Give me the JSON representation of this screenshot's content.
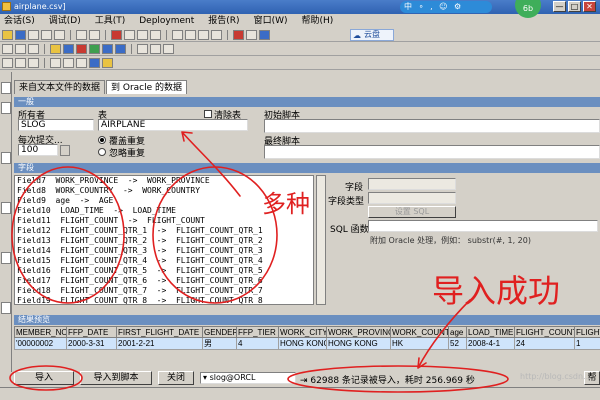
{
  "window": {
    "title": "airplane.csv]",
    "ime_text": "中 ∘ , ☺ ⚙",
    "controls": [
      "—",
      "□",
      "✕"
    ],
    "avatar_text": "6b"
  },
  "menu": [
    "会话(S)",
    "调试(D)",
    "工具(T)",
    "Deployment",
    "报告(R)",
    "窗口(W)",
    "帮助(H)"
  ],
  "cloud_label": "云盘",
  "tabs": [
    "来自文本文件的数据",
    "到 Oracle 的数据"
  ],
  "general": {
    "section_title": "一般",
    "owner_label": "所有者",
    "owner_value": "SLOG",
    "table_label": "表",
    "table_value": "AIRPLANE",
    "truncate_label": "清除表",
    "commit_label": "每次提交...",
    "commit_value": "100",
    "radio_overwrite": "覆盖重复",
    "radio_ignore": "忽略重复",
    "initial_script_label": "初始脚本",
    "final_script_label": "最终脚本"
  },
  "fields": {
    "section_title": "字段",
    "rows": [
      "Field7  WORK_PROVINCE  ->  WORK_PROVINCE",
      "Field8  WORK_COUNTRY  ->  WORK_COUNTRY",
      "Field9  age  ->  AGE",
      "Field10  LOAD_TIME  ->  LOAD_TIME",
      "Field11  FLIGHT_COUNT  ->  FLIGHT_COUNT",
      "Field12  FLIGHT_COUNT_QTR_1  ->  FLIGHT_COUNT_QTR_1",
      "Field13  FLIGHT_COUNT_QTR_2  ->  FLIGHT_COUNT_QTR_2",
      "Field14  FLIGHT_COUNT_QTR_3  ->  FLIGHT_COUNT_QTR_3",
      "Field15  FLIGHT_COUNT_QTR_4  ->  FLIGHT_COUNT_QTR_4",
      "Field16  FLIGHT_COUNT_QTR_5  ->  FLIGHT_COUNT_QTR_5",
      "Field17  FLIGHT_COUNT_QTR_6  ->  FLIGHT_COUNT_QTR_6",
      "Field18  FLIGHT_COUNT_QTR_7  ->  FLIGHT_COUNT_QTR_7",
      "Field19  FLIGHT_COUNT_QTR_8  ->  FLIGHT_COUNT_QTR_8",
      "Field20  AVG_CLASS_COUNT  ->  AVG_CLASS_COUNT"
    ],
    "field_label": "字段",
    "field_type_label": "字段类型",
    "sql_button_label": "设置 SQL",
    "sql_func_label": "SQL 函数",
    "sql_hint": "附加 Oracle 处理，例如： substr(#, 1, 20)"
  },
  "results": {
    "section_title": "结果预览",
    "columns": [
      "MEMBER_NO",
      "FFP_DATE",
      "FIRST_FLIGHT_DATE",
      "GENDER",
      "FFP_TIER",
      "WORK_CITY",
      "WORK_PROVINCE",
      "WORK_COUNTRY",
      "age",
      "LOAD_TIME",
      "FLIGHT_COUNT",
      "FLIGHT"
    ],
    "row": [
      "'00000002",
      "2000-3-31",
      "2001-2-21",
      "男",
      "4",
      "HONG KONG",
      "HONG KONG",
      "HK",
      "52",
      "2008-4-1",
      "24",
      "1"
    ]
  },
  "bottom": {
    "import_button": "导入",
    "import_script_button": "导入到脚本",
    "close_button": "关闭",
    "connection": "slog@ORCL",
    "status_message": "62988 条记录被导入，耗时 256.969 秒",
    "help_button": "帮"
  },
  "annotations": {
    "handwritten_1": "多种",
    "handwritten_2": "导入成功"
  },
  "watermark": "http://blog.csdn..."
}
